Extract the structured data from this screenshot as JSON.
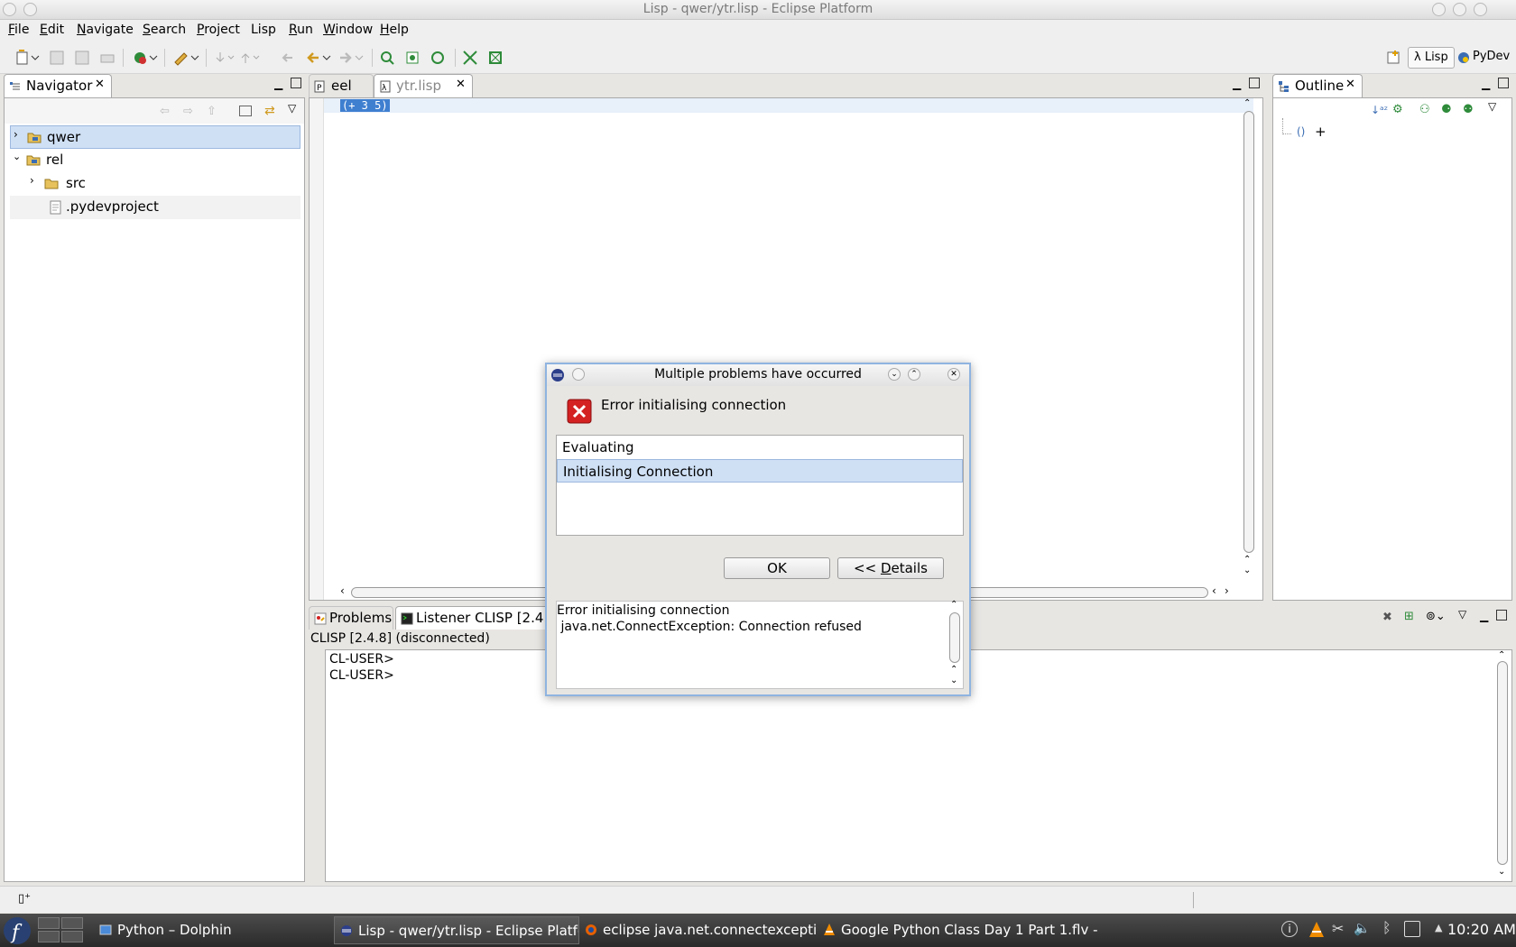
{
  "window": {
    "title": "Lisp - qwer/ytr.lisp - Eclipse Platform"
  },
  "menu": {
    "items": [
      {
        "label": "File",
        "mnemonic": "F",
        "rest": "ile"
      },
      {
        "label": "Edit",
        "mnemonic": "E",
        "rest": "dit"
      },
      {
        "label": "Navigate",
        "mnemonic": "N",
        "rest": "avigate"
      },
      {
        "label": "Search",
        "mnemonic": "S",
        "rest": "earch"
      },
      {
        "label": "Project",
        "mnemonic": "P",
        "rest": "roject"
      },
      {
        "label": "Lisp",
        "mnemonic": "",
        "rest": "Lisp"
      },
      {
        "label": "Run",
        "mnemonic": "R",
        "rest": "un"
      },
      {
        "label": "Window",
        "mnemonic": "W",
        "rest": "indow"
      },
      {
        "label": "Help",
        "mnemonic": "H",
        "rest": "elp"
      }
    ]
  },
  "perspectives": [
    {
      "label": "λ Lisp",
      "active": true
    },
    {
      "label": "PyDev",
      "active": false
    }
  ],
  "navigator": {
    "tab_label": "Navigator",
    "tree": [
      {
        "label": "qwer",
        "icon": "project-folder-icon",
        "expanded": false,
        "selected": true
      },
      {
        "label": "rel",
        "icon": "project-folder-icon",
        "expanded": true
      },
      {
        "label": "src",
        "icon": "folder-icon",
        "expanded": false
      },
      {
        "label": ".pydevproject",
        "icon": "file-icon"
      }
    ]
  },
  "editor": {
    "tabs": [
      {
        "label": "eel",
        "active": false
      },
      {
        "label": "ytr.lisp",
        "active": true
      }
    ],
    "code_line": "(+ 3 5)"
  },
  "outline": {
    "tab_label": "Outline",
    "item": "+"
  },
  "console": {
    "tabs": [
      {
        "label": "Problems"
      },
      {
        "label": "Listener CLISP [2.4.8]"
      }
    ],
    "header": "CLISP [2.4.8] (disconnected)",
    "lines": [
      "CL-USER>",
      "CL-USER>"
    ]
  },
  "dialog": {
    "title": "Multiple problems have occurred",
    "message": "Error initialising connection",
    "problems": [
      "Evaluating",
      "Initialising Connection"
    ],
    "selected_index": 1,
    "ok_label": "OK",
    "details_prefix": "<< ",
    "details_mnemonic": "D",
    "details_rest": "etails",
    "details_line1": "Error initialising connection",
    "details_line2": " java.net.ConnectException: Connection refused"
  },
  "taskbar": {
    "tasks": [
      {
        "label": "Python – Dolphin",
        "icon": "dolphin-icon",
        "active": false
      },
      {
        "label": "Lisp - qwer/ytr.lisp - Eclipse Platform",
        "icon": "eclipse-icon",
        "active": true
      },
      {
        "label": "eclipse java.net.connectexception",
        "icon": "firefox-icon",
        "active": false
      },
      {
        "label": "Google Python Class Day 1 Part 1.flv -",
        "icon": "vlc-icon",
        "active": false
      }
    ],
    "clock": "10:20 AM"
  },
  "colors": {
    "selection": "#cfe0f5",
    "dialog_border": "#8fb4e0",
    "error_red": "#d42121",
    "folder_yellow": "#e7c25c",
    "code_highlight": "#3f7fd0"
  }
}
